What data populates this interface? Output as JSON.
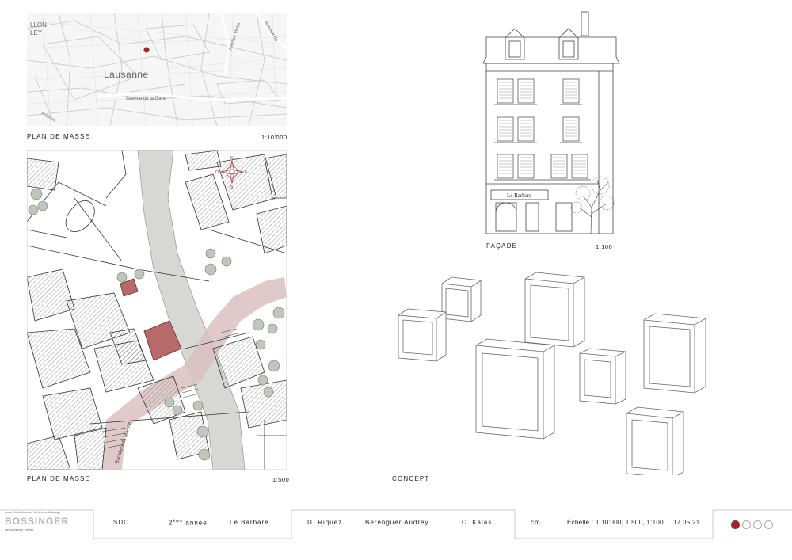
{
  "location_map": {
    "city_label": "Lausanne",
    "street_1": "Avenue de la Gare",
    "street_2": "Avenue Victor",
    "street_3": "Avenue de",
    "street_4": "Avenue",
    "corner_1": "LLON",
    "corner_2": "LEY",
    "caption": "PLAN DE MASSE",
    "scale": "1:10'000",
    "marker_color": "#9e2a2b"
  },
  "site_plan": {
    "caption": "PLAN DE MASSE",
    "scale": "1:500",
    "street_label": "Escaliers du Marché",
    "compass": {
      "n": "N",
      "s": "S",
      "e": "E",
      "o": "O"
    },
    "highlight_color": "#b86a68",
    "path_color": "#d9c0c0",
    "river_color": "#d8d8d3"
  },
  "facade": {
    "caption": "FAÇADE",
    "scale": "1:100",
    "shop_sign": "Le Barbare"
  },
  "concept": {
    "caption": "CONCEPT"
  },
  "footer": {
    "logo_small_text": "école d'architecture, d'intérieur & design",
    "logo_main": "BOSSINGER",
    "logo_sub": "swiss design center",
    "course": "SDC",
    "year_number": "2",
    "year_suffix": "ème",
    "year_word": "année",
    "project": "Le Barbare",
    "author_1": "D. Riquez",
    "author_2": "Berenguer Audrey",
    "author_3": "C. Kalas",
    "unit": "cm",
    "scale_label": "Échelle : 1:10'000, 1:500, 1:100",
    "date": "17.05.21",
    "page_dots": [
      true,
      false,
      false,
      false
    ],
    "accent_color": "#9e2a2b"
  }
}
